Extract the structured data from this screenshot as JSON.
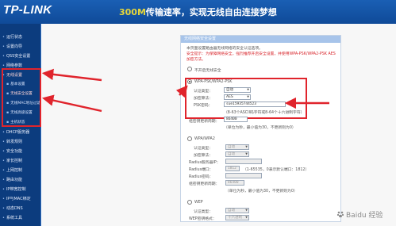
{
  "header": {
    "logo": "TP-LINK",
    "tagline_highlight": "300M",
    "tagline_rest": "传输速率，实现无线自由连接梦想"
  },
  "sidebar": {
    "items": [
      {
        "label": "运行状态"
      },
      {
        "label": "设置向导"
      },
      {
        "label": "QSS安全设置"
      },
      {
        "label": "网络参数"
      },
      {
        "label": "无线设置"
      },
      {
        "label": "基本设置"
      },
      {
        "label": "无线安全设置"
      },
      {
        "label": "无线MAC地址过滤"
      },
      {
        "label": "无线高级设置"
      },
      {
        "label": "主机状态"
      },
      {
        "label": "DHCP服务器"
      },
      {
        "label": "转发规则"
      },
      {
        "label": "安全功能"
      },
      {
        "label": "家长控制"
      },
      {
        "label": "上网控制"
      },
      {
        "label": "路由功能"
      },
      {
        "label": "IP带宽控制"
      },
      {
        "label": "IP与MAC绑定"
      },
      {
        "label": "动态DNS"
      },
      {
        "label": "系统工具"
      }
    ]
  },
  "panel": {
    "title": "无线网络安全设置",
    "intro1": "本页面设置路由器无线网络的安全认证选项。",
    "intro2": "安全提示：为保障网络安全，强烈推荐开启安全设置，并使用WPA-PSK/WPA2-PSK AES",
    "intro3": "加密方法。",
    "opt_none": "不开启无线安全",
    "opt_wpa_psk": "WPA-PSK/WPA2-PSK",
    "auth_type_label": "认证类型：",
    "auth_type_value": "自动",
    "enc_label": "加密算法：",
    "enc_value": "AES",
    "psk_label": "PSK密码：",
    "psk_value": "sue15935744523",
    "psk_hint": "（8-63个ASCII码字符或8-64个十六进制字符）",
    "group_key_label": "组密钥更新周期：",
    "group_key_value": "86400",
    "group_key_hint": "（单位为秒，最小值为30，不更新则为0）",
    "opt_wpa": "WPA/WPA2",
    "wpa_auth_label": "认证类型：",
    "wpa_auth_value": "自动",
    "wpa_enc_label": "加密算法：",
    "wpa_enc_value": "自动",
    "radius_ip_label": "Radius服务器IP：",
    "radius_port_label": "Radius端口：",
    "radius_port_value": "1812",
    "radius_port_hint": "（1-65535，0表示默认端口：1812）",
    "radius_pwd_label": "Radius密码：",
    "wpa_group_label": "组密钥更新周期：",
    "wpa_group_value": "86400",
    "wpa_group_hint": "（单位为秒，最小值为30，不更新则为0）",
    "opt_wep": "WEP",
    "wep_auth_label": "认证类型：",
    "wep_auth_value": "自动",
    "wep_fmt_label": "WEP密钥格式：",
    "wep_fmt_value": "十六进制"
  },
  "watermark": "Baidu 经验",
  "colors": {
    "header_blue": "#1a5fb4",
    "sidebar_blue": "#0c3c7e",
    "highlight_red": "#e0242c",
    "panel_title": "#a7c4ea"
  }
}
